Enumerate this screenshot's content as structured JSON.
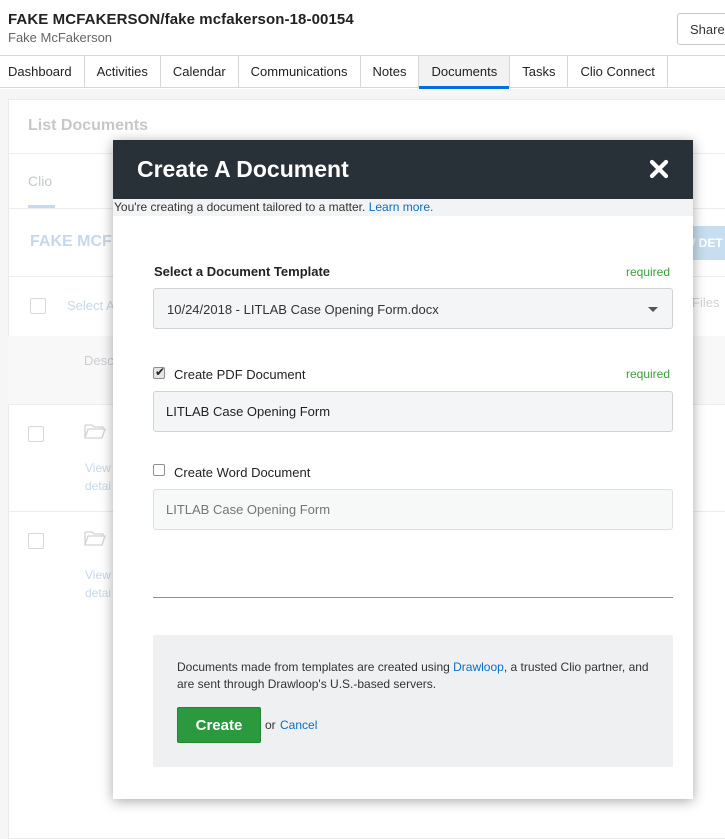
{
  "header": {
    "matter_title": "FAKE MCFAKERSON/fake mcfakerson-18-00154",
    "client_name": "Fake McFakerson",
    "share_label": "Share"
  },
  "tabs": [
    {
      "label": "Dashboard"
    },
    {
      "label": "Activities"
    },
    {
      "label": "Calendar"
    },
    {
      "label": "Communications"
    },
    {
      "label": "Notes"
    },
    {
      "label": "Documents",
      "active": true
    },
    {
      "label": "Tasks"
    },
    {
      "label": "Clio Connect"
    }
  ],
  "background": {
    "page_title": "List Documents",
    "sub_tab": "Clio",
    "matter_heading": "FAKE MCF",
    "view_details_button": "W DET",
    "select_all": "Select A",
    "files_label": "Files",
    "description_header": "Desc",
    "row_link_line1": "View",
    "row_link_line2": "detai"
  },
  "modal": {
    "title": "Create A Document",
    "subtitle": "You're creating a document tailored to a matter.",
    "learn_more": "Learn more.",
    "template_label": "Select a Document Template",
    "required_label": "required",
    "template_value": "10/24/2018 - LITLAB Case Opening Form.docx",
    "pdf_checkbox_label": "Create PDF Document",
    "pdf_checked": true,
    "pdf_name_value": "LITLAB Case Opening Form",
    "word_checkbox_label": "Create Word Document",
    "word_checked": false,
    "word_name_placeholder": "LITLAB Case Opening Form",
    "info_text_before": "Documents made from templates are created using",
    "info_link": "Drawloop",
    "info_text_after": ", a trusted Clio partner, and are sent through Drawloop's U.S.-based servers.",
    "create_label": "Create",
    "or_label": "or",
    "cancel_label": "Cancel"
  },
  "colors": {
    "modal_header_bg": "#283138",
    "create_button": "#2b9a3e",
    "required_text": "#3aa03a",
    "link": "#0b6ec5",
    "active_tab_indicator": "#0070e0"
  }
}
